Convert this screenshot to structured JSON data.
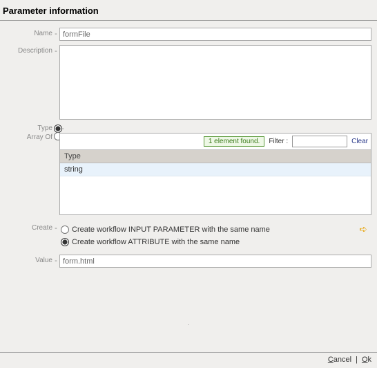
{
  "header": {
    "title": "Parameter information"
  },
  "labels": {
    "name": "Name",
    "description": "Description",
    "type": "Type",
    "array_of": "Array Of",
    "create": "Create",
    "value": "Value"
  },
  "fields": {
    "name_value": "formFile",
    "description_value": "",
    "value_value": "form.html"
  },
  "type_panel": {
    "found_text": "1 element found.",
    "filter_label": "Filter :",
    "filter_value": "",
    "clear_label": "Clear",
    "column_header": "Type",
    "items": [
      "string"
    ]
  },
  "create_options": {
    "opt_input": "Create workflow INPUT PARAMETER with the same name",
    "opt_attr": "Create workflow ATTRIBUTE with the same name",
    "selected": "attr"
  },
  "footer": {
    "cancel": "Cancel",
    "ok": "Ok"
  }
}
